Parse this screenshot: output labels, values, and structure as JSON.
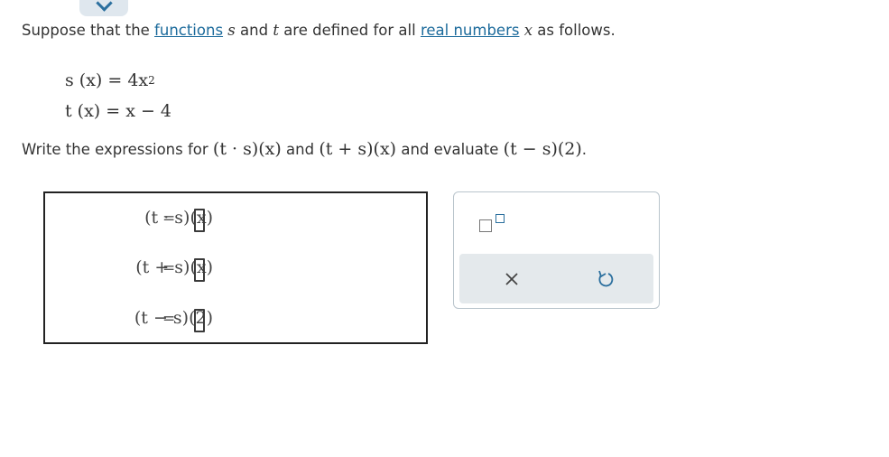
{
  "intro": {
    "prefix": "Suppose that the ",
    "functions_link": "functions",
    "var_s": "s",
    "and_word": " and ",
    "var_t": "t",
    "middle": " are defined for all ",
    "real_numbers_link": "real numbers",
    "var_x": "x",
    "suffix": " as follows."
  },
  "definitions": [
    {
      "expr": "s (x) = 4x",
      "exponent": "2"
    },
    {
      "expr": "t (x) = x − 4",
      "exponent": ""
    }
  ],
  "instruction": {
    "prefix": "Write the expressions for ",
    "expr1": "(t · s)(x)",
    "and1": " and ",
    "expr2": "(t + s)(x)",
    "middle": " and evaluate ",
    "expr3": "(t − s)(2)",
    "end": "."
  },
  "answers": [
    {
      "lhs": "(t · s)(x)",
      "eq": "=",
      "value": ""
    },
    {
      "lhs": "(t + s)(x)",
      "eq": "=",
      "value": ""
    },
    {
      "lhs": "(t − s)(2)",
      "eq": "=",
      "value": ""
    }
  ],
  "toolbar": {
    "exponent_icon": "exponent-template-icon",
    "clear_icon": "close-icon",
    "undo_icon": "undo-icon"
  },
  "colors": {
    "link": "#1b6a9b",
    "accent": "#2b6f9e",
    "action_bar": "#e4e9ec"
  }
}
